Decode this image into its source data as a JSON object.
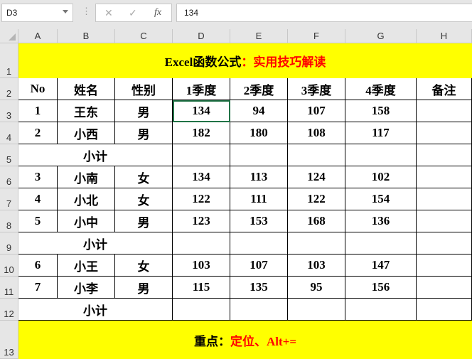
{
  "name_box": "D3",
  "formula_value": "134",
  "formula_buttons": {
    "cancel": "✕",
    "enter": "✓",
    "fx": "fx"
  },
  "columns": [
    "A",
    "B",
    "C",
    "D",
    "E",
    "F",
    "G",
    "H"
  ],
  "rows": [
    "1",
    "2",
    "3",
    "4",
    "5",
    "6",
    "7",
    "8",
    "9",
    "10",
    "11",
    "12",
    "13"
  ],
  "title": {
    "black": "Excel函数公式",
    "red": "：实用技巧解读"
  },
  "headers": [
    "No",
    "姓名",
    "性别",
    "1季度",
    "2季度",
    "3季度",
    "4季度",
    "备注"
  ],
  "subtotal_label": "小计",
  "data_rows": [
    [
      "1",
      "王东",
      "男",
      "134",
      "94",
      "107",
      "158",
      ""
    ],
    [
      "2",
      "小西",
      "男",
      "182",
      "180",
      "108",
      "117",
      ""
    ],
    null,
    [
      "3",
      "小南",
      "女",
      "134",
      "113",
      "124",
      "102",
      ""
    ],
    [
      "4",
      "小北",
      "女",
      "122",
      "111",
      "122",
      "154",
      ""
    ],
    [
      "5",
      "小中",
      "男",
      "123",
      "153",
      "168",
      "136",
      ""
    ],
    null,
    [
      "6",
      "小王",
      "女",
      "103",
      "107",
      "103",
      "147",
      ""
    ],
    [
      "7",
      "小李",
      "男",
      "115",
      "135",
      "95",
      "156",
      ""
    ],
    null
  ],
  "footer": {
    "black": "重点：",
    "red": "定位、Alt+="
  },
  "colors": {
    "highlight": "#ffff00",
    "accent_text": "#ff0000"
  }
}
